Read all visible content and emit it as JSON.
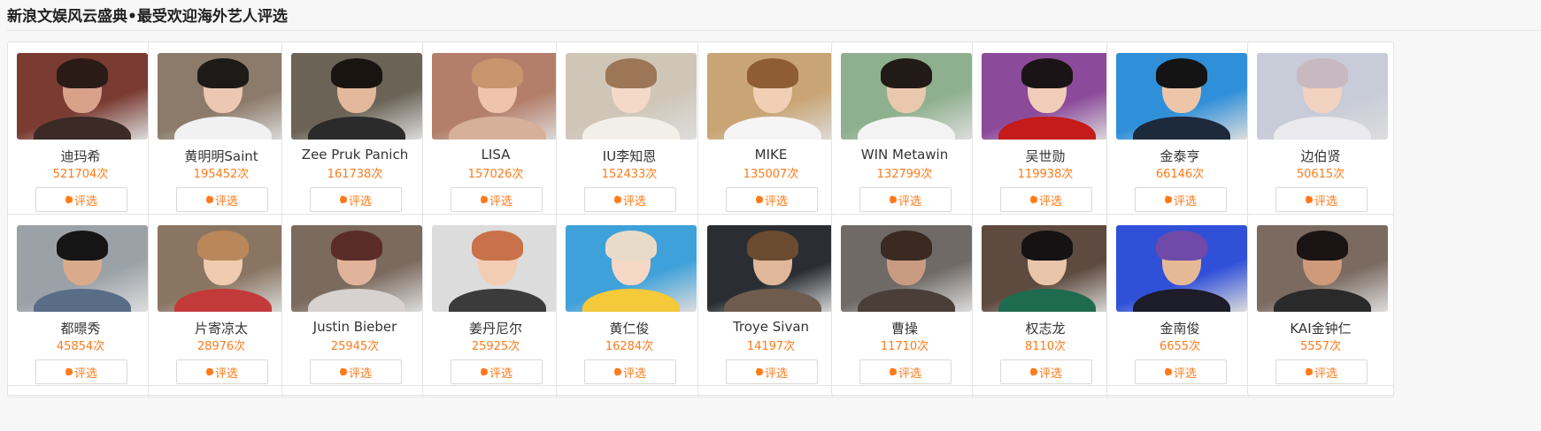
{
  "page": {
    "title": "新浪文娱风云盛典•最受欢迎海外艺人评选",
    "vote_label": "评选",
    "vote_suffix": "次"
  },
  "artists": [
    {
      "name": "迪玛希",
      "votes": "521704次",
      "photo_colors": [
        "#7a3b32",
        "#d9a08a",
        "#2a1b17",
        "#3b2a26"
      ]
    },
    {
      "name": "黄明明Saint",
      "votes": "195452次",
      "photo_colors": [
        "#8c7b6a",
        "#ecc8b3",
        "#1e1a18",
        "#f1f1f1"
      ]
    },
    {
      "name": "Zee Pruk Panich",
      "votes": "161738次",
      "photo_colors": [
        "#6b6356",
        "#e3b89c",
        "#1a1411",
        "#2b2b2b"
      ]
    },
    {
      "name": "LISA",
      "votes": "157026次",
      "photo_colors": [
        "#b47f6a",
        "#efc4ab",
        "#c9956f",
        "#d7b09a"
      ]
    },
    {
      "name": "IU李知恩",
      "votes": "152433次",
      "photo_colors": [
        "#cfc6b8",
        "#f5d9c8",
        "#9c7656",
        "#f2efe9"
      ]
    },
    {
      "name": "MIKE",
      "votes": "135007次",
      "photo_colors": [
        "#c9a575",
        "#f0cfb4",
        "#8e5d34",
        "#f5f5f5"
      ]
    },
    {
      "name": "WIN Metawin",
      "votes": "132799次",
      "photo_colors": [
        "#8fb08e",
        "#eac8ae",
        "#221a16",
        "#f3f3f3"
      ]
    },
    {
      "name": "吴世勋",
      "votes": "119938次",
      "photo_colors": [
        "#8b4a9a",
        "#f0cdb8",
        "#1b1416",
        "#c41b1b"
      ]
    },
    {
      "name": "金泰亨",
      "votes": "66146次",
      "photo_colors": [
        "#2f8fd9",
        "#edc5a8",
        "#141414",
        "#1c2a3c"
      ]
    },
    {
      "name": "边伯贤",
      "votes": "50615次",
      "photo_colors": [
        "#c8cbd8",
        "#f2d2c0",
        "#c8b8c0",
        "#e9e9ee"
      ]
    },
    {
      "name": "都暻秀",
      "votes": "45854次",
      "photo_colors": [
        "#9aa1a7",
        "#d9ab8c",
        "#151515",
        "#5a6d86"
      ]
    },
    {
      "name": "片寄凉太",
      "votes": "28976次",
      "photo_colors": [
        "#8a7562",
        "#f0cbb0",
        "#b9875a",
        "#c33a3a"
      ]
    },
    {
      "name": "Justin Bieber",
      "votes": "25945次",
      "photo_colors": [
        "#7b6a5e",
        "#e1b39a",
        "#5a2d2b",
        "#d7d2cf"
      ]
    },
    {
      "name": "姜丹尼尔",
      "votes": "25925次",
      "photo_colors": [
        "#dcdcdc",
        "#f2cdb4",
        "#c9714a",
        "#3b3b3b"
      ]
    },
    {
      "name": "黄仁俊",
      "votes": "16284次",
      "photo_colors": [
        "#3fa1d9",
        "#f6d6c4",
        "#e8dcc9",
        "#f4c93a"
      ]
    },
    {
      "name": "Troye Sivan",
      "votes": "14197次",
      "photo_colors": [
        "#2a2e33",
        "#e0b79b",
        "#6b4b30",
        "#6e5d4e"
      ]
    },
    {
      "name": "曹操",
      "votes": "11710次",
      "photo_colors": [
        "#6f6a66",
        "#c99c82",
        "#3a2a22",
        "#4a3e38"
      ]
    },
    {
      "name": "权志龙",
      "votes": "8110次",
      "photo_colors": [
        "#5e4a3e",
        "#e8c4a8",
        "#141212",
        "#1f6b4f"
      ]
    },
    {
      "name": "金南俊",
      "votes": "6655次",
      "photo_colors": [
        "#3050d8",
        "#e6b996",
        "#6f4aa8",
        "#1c1c2a"
      ]
    },
    {
      "name": "KAI金钟仁",
      "votes": "5557次",
      "photo_colors": [
        "#7a6a60",
        "#cf9a7a",
        "#1a1514",
        "#2a2a2a"
      ]
    }
  ]
}
